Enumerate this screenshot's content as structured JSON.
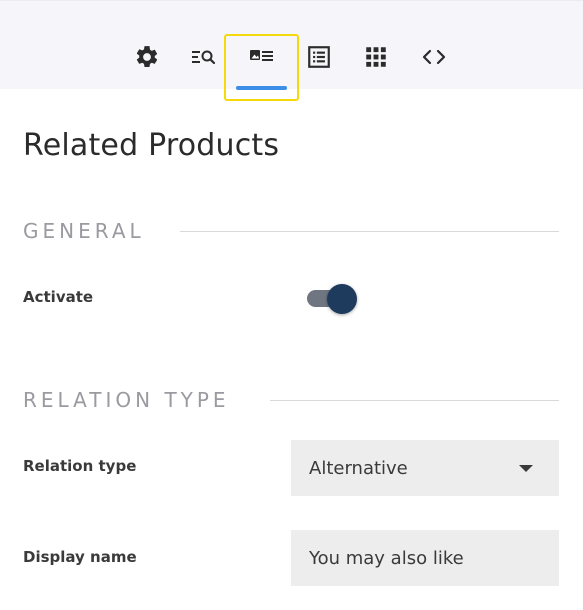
{
  "toolbar": {
    "tools": [
      {
        "icon": "gear-icon"
      },
      {
        "icon": "search-list-icon"
      },
      {
        "icon": "image-text-icon",
        "active": true
      },
      {
        "icon": "list-icon"
      },
      {
        "icon": "grid-icon"
      },
      {
        "icon": "code-icon"
      }
    ],
    "accent_color": "#3d8ee8",
    "highlight_color": "#f5d90a"
  },
  "page": {
    "title": "Related Products"
  },
  "sections": {
    "general": {
      "heading": "GENERAL",
      "activate_label": "Activate",
      "activate_on": true
    },
    "relation_type": {
      "heading": "RELATION TYPE",
      "relation_label": "Relation type",
      "relation_value": "Alternative",
      "display_name_label": "Display name",
      "display_name_placeholder": "You may also like"
    }
  }
}
